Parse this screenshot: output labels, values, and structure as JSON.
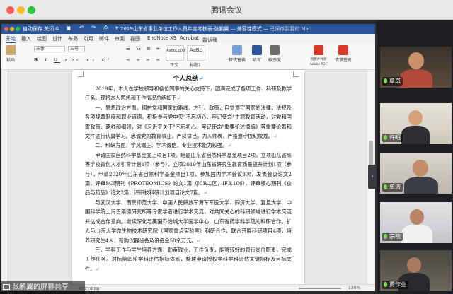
{
  "app": {
    "title": "腾讯会议"
  },
  "word": {
    "autosave_label": "自动保存",
    "autosave_state": "关闭",
    "doc_title": "2019山东省事业单位工作人员年度考核表-张鹏翼",
    "compat_mode": "兼容性模式",
    "save_state": "已保存到我的 Mac",
    "tabs": [
      "开始",
      "插入",
      "绘图",
      "设计",
      "布局",
      "引用",
      "邮件",
      "审阅",
      "视图",
      "EndNote X9",
      "Acrobat",
      "告诉我"
    ],
    "ribbon": {
      "paste": "粘贴",
      "font_name": "宋体",
      "font_size": "三号",
      "styles": [
        {
          "preview": "AaBbCcDd",
          "name": "正文"
        },
        {
          "preview": "AaBb",
          "name": "标题1"
        }
      ],
      "style_pane": "样式窗格",
      "dictate": "听写",
      "sensitivity": "敏感度",
      "create_pdf": "创建并共享 Adobe PDF",
      "request_sign": "请求签名"
    },
    "status": {
      "word_count": "中文(中国)",
      "zoom": "138%"
    }
  },
  "document": {
    "heading": "个人总结",
    "paragraphs": [
      "2019年，本人在学校领导和各位同事的关心支持下，圆满完成了各项工作、科研及教学任务。现将本人思想和工作情况总结如下",
      "一、思想政治方面。拥护党和国家的路线、方针、政策，自觉遵守国家的法律、法规及各项规章制度和职业道德。积极参与党中央\"不忘初心、牢记使命\"主题教育活动，对党和国家政策、路线和纲领，对《习近平关于\"不忘初心、牢记使命\"重要论述摘编》等重要论著和文件进行认真学习。忠诚党的教育事业，严以律己，为人师表，严格遵守校纪校规。",
      "二、科研方面，学风端正、学术诚信，专业技术能力较强。",
      "申请国家自然科学基金面上项目1项。结题山东省自然科学基金项目2项，立项山东省高等学校青创人才引育计划1项（参与），立项2019年山东省研究生教育质量提升计划1项（参与），申请2020年山东省自然科学基金项目1项，参加国内学术会议3次，发表会议论文2篇，评审SCI期刊《PROTEOMICS》论文1篇（JCR二区，IF3.106），评审核心期刊《食品与药品》论文2篇，评审校科研计划项目论文7篇。",
      "与武汉大学、南京师范大学、中国人民解放军海军军医大学、同济大学、复旦大学、中国科学院上海巴斯德研究所等专家学者进行学术交流，对共同关心的科研领域进行学术交流并达成合作意向。继续深化与美国乔治城大学医学中心、山东省药学科学院的科研合作。扩大与山东大学微生物技术研究院（国家重点实验室）科研合作，联合开展科研项目4项，培养研究生4人，新购仪器设备及设备金50余万元。",
      "三、学科工作与学生培养方面，勤奋敬业，工作负责，能够较好的履行岗位职责，完成工作任务。对标第四轮学科评估指标体系，整理申请授权学科学科评估关键指标及目标文件。"
    ]
  },
  "meeting": {
    "participants": [
      {
        "name": "章岚",
        "mic": "on"
      },
      {
        "name": "许昭",
        "mic": "on"
      },
      {
        "name": "单涛",
        "mic": "on"
      },
      {
        "name": "宗晓",
        "mic": "on"
      },
      {
        "name": "贾作业",
        "mic": "on"
      }
    ],
    "share_banner": "张鹏翼的屏幕共享"
  },
  "colors": {
    "word_blue": "#2b579a",
    "traffic_red": "#fd5f57",
    "traffic_yellow": "#febc2e",
    "traffic_green": "#28c840",
    "mic_green": "#7ed957"
  }
}
